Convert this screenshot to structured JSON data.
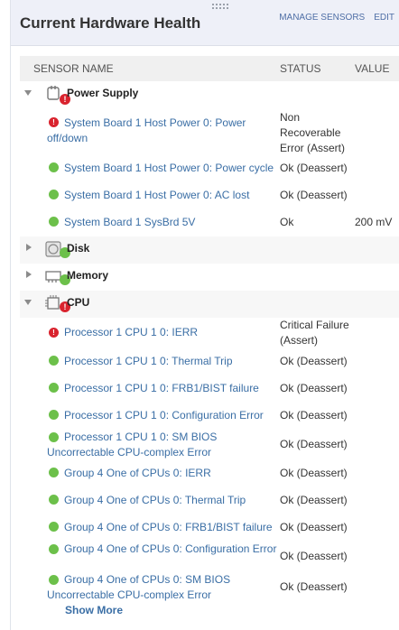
{
  "widget": {
    "title": "Current Hardware Health",
    "manage_label": "MANAGE SENSORS",
    "edit_label": "EDIT"
  },
  "columns": {
    "name": "SENSOR NAME",
    "status": "STATUS",
    "value": "VALUE"
  },
  "groups": [
    {
      "label": "Power Supply",
      "expanded": true,
      "state": "error",
      "icon": "power-plug-icon"
    },
    {
      "label": "Disk",
      "expanded": false,
      "state": "ok",
      "icon": "disk-icon"
    },
    {
      "label": "Memory",
      "expanded": false,
      "state": "ok",
      "icon": "memory-icon"
    },
    {
      "label": "CPU",
      "expanded": true,
      "state": "error",
      "icon": "cpu-chip-icon"
    }
  ],
  "power_sensors": [
    {
      "name": "System Board 1 Host Power 0: Power off/down",
      "status": "Non Recoverable Error (Assert)",
      "value": "",
      "state": "error"
    },
    {
      "name": "System Board 1 Host Power 0: Power cycle",
      "status": "Ok (Deassert)",
      "value": "",
      "state": "ok"
    },
    {
      "name": "System Board 1 Host Power 0: AC lost",
      "status": "Ok (Deassert)",
      "value": "",
      "state": "ok"
    },
    {
      "name": "System Board 1 SysBrd 5V",
      "status": "Ok",
      "value": "200 mV",
      "state": "ok"
    }
  ],
  "cpu_sensors": [
    {
      "name": "Processor 1 CPU 1 0: IERR",
      "status": "Critical Failure (Assert)",
      "value": "",
      "state": "error"
    },
    {
      "name": "Processor 1 CPU 1 0: Thermal Trip",
      "status": "Ok (Deassert)",
      "value": "",
      "state": "ok"
    },
    {
      "name": "Processor 1 CPU 1 0: FRB1/BIST failure",
      "status": "Ok (Deassert)",
      "value": "",
      "state": "ok"
    },
    {
      "name": "Processor 1 CPU 1 0: Configuration Error",
      "status": "Ok (Deassert)",
      "value": "",
      "state": "ok"
    },
    {
      "name": "Processor 1 CPU 1 0: SM BIOS Uncorrectable CPU-complex Error",
      "status": "Ok (Deassert)",
      "value": "",
      "state": "ok"
    },
    {
      "name": "Group 4 One of CPUs 0: IERR",
      "status": "Ok (Deassert)",
      "value": "",
      "state": "ok"
    },
    {
      "name": "Group 4 One of CPUs 0: Thermal Trip",
      "status": "Ok (Deassert)",
      "value": "",
      "state": "ok"
    },
    {
      "name": "Group 4 One of CPUs 0: FRB1/BIST failure",
      "status": "Ok (Deassert)",
      "value": "",
      "state": "ok"
    },
    {
      "name": "Group 4 One of CPUs 0: Configuration Error",
      "status": "Ok (Deassert)",
      "value": "",
      "state": "ok"
    },
    {
      "name": "Group 4 One of CPUs 0: SM BIOS Uncorrectable CPU-complex Error",
      "status": "Ok (Deassert)",
      "value": "",
      "state": "ok"
    }
  ],
  "show_more_label": "Show More",
  "colors": {
    "ok": "#6cc04a",
    "error": "#d9232e",
    "link": "#3a6ea5",
    "header_bg": "#eef0f8"
  }
}
